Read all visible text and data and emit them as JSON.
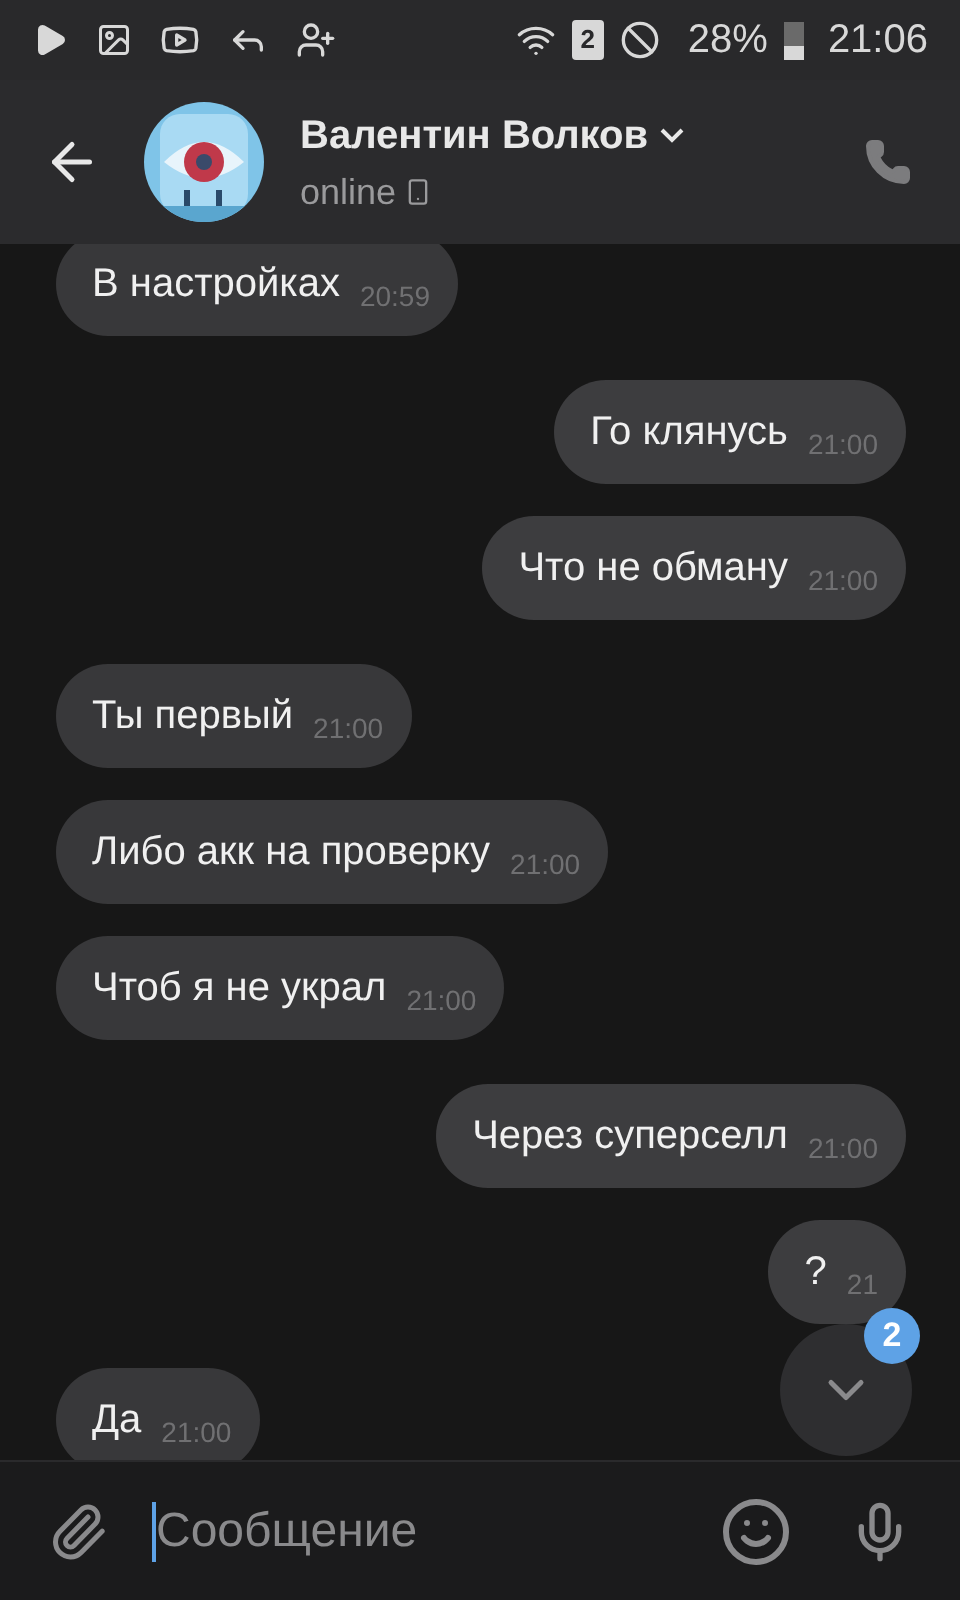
{
  "status_bar": {
    "sim": "2",
    "battery": "28%",
    "time": "21:06"
  },
  "header": {
    "name": "Валентин Волков",
    "status": "online"
  },
  "messages": [
    {
      "text": "В настройках",
      "time": "20:59",
      "outgoing": false
    },
    {
      "text": "Го клянусь",
      "time": "21:00",
      "outgoing": true
    },
    {
      "text": "Что не обману",
      "time": "21:00",
      "outgoing": true
    },
    {
      "text": "Ты первый",
      "time": "21:00",
      "outgoing": false
    },
    {
      "text": "Либо акк на проверку",
      "time": "21:00",
      "outgoing": false
    },
    {
      "text": "Чтоб я не украл",
      "time": "21:00",
      "outgoing": false
    },
    {
      "text": "Через суперселл",
      "time": "21:00",
      "outgoing": true
    },
    {
      "text": "?",
      "time": "21",
      "outgoing": true
    },
    {
      "text": "Да",
      "time": "21:00",
      "outgoing": false
    }
  ],
  "scroll_button": {
    "badge": "2"
  },
  "composer": {
    "placeholder": "Сообщение"
  }
}
